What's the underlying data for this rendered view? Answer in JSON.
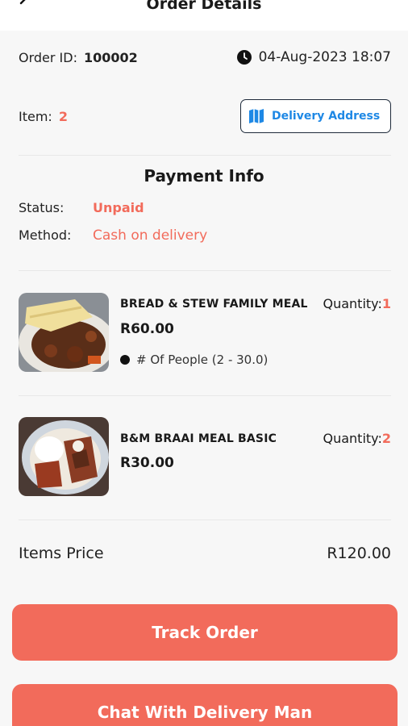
{
  "header": {
    "title": "Order Details",
    "back_icon": "arrow-left-icon"
  },
  "order": {
    "id_label": "Order ID:",
    "id_value": "100002",
    "clock_icon": "clock-icon",
    "datetime": "04-Aug-2023 18:07",
    "item_label": "Item:",
    "item_count": "2",
    "delivery_button": "Delivery Address",
    "map_icon": "map-icon"
  },
  "payment": {
    "title": "Payment Info",
    "status_label": "Status:",
    "status_value": "Unpaid",
    "method_label": "Method:",
    "method_value": "Cash on delivery"
  },
  "items": [
    {
      "name": "BREAD & STEW FAMILY MEAL",
      "price": "R60.00",
      "qty_label": "Quantity:",
      "qty": "1",
      "variation": "# Of People (2 - 30.0)"
    },
    {
      "name": "B&M BRAAI MEAL BASIC",
      "price": "R30.00",
      "qty_label": "Quantity:",
      "qty": "2"
    }
  ],
  "summary": {
    "items_price_label": "Items Price",
    "items_price_value": "R120.00"
  },
  "actions": {
    "track": "Track Order",
    "chat": "Chat With Delivery Man"
  },
  "colors": {
    "accent": "#f26b5b",
    "link": "#1e88e5"
  }
}
